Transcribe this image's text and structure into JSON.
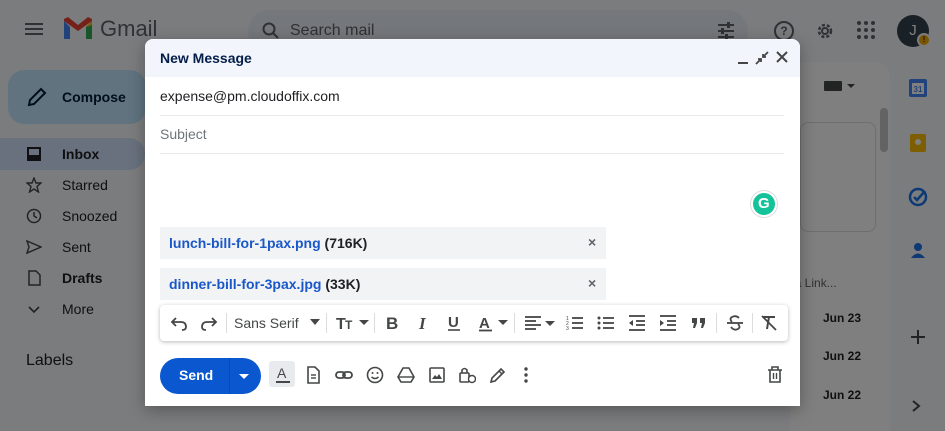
{
  "app": {
    "name": "Gmail",
    "search_placeholder": "Search mail",
    "avatar_letter": "J",
    "avatar_badge": "!"
  },
  "compose_button": {
    "label": "Compose"
  },
  "sidebar": {
    "items": [
      {
        "label": "Inbox",
        "icon": "inbox-icon",
        "active": true
      },
      {
        "label": "Starred",
        "icon": "star-icon"
      },
      {
        "label": "Snoozed",
        "icon": "clock-icon"
      },
      {
        "label": "Sent",
        "icon": "send-icon"
      },
      {
        "label": "Drafts",
        "icon": "draft-icon"
      },
      {
        "label": "More",
        "icon": "chevron-down-icon"
      }
    ],
    "labels_heading": "Labels"
  },
  "mail_list": {
    "fragment": "ia Link...",
    "dates": [
      "Jun 23",
      "Jun 22",
      "Jun 22"
    ]
  },
  "compose": {
    "title": "New Message",
    "to": "expense@pm.cloudoffix.com",
    "subject_placeholder": "Subject",
    "attachments": [
      {
        "name": "lunch-bill-for-1pax.png",
        "size": "(716K)"
      },
      {
        "name": "dinner-bill-for-3pax.jpg",
        "size": "(33K)"
      }
    ],
    "attachment_remove": "×",
    "grammarly_letter": "G",
    "font": "Sans Serif",
    "send_label": "Send"
  },
  "colors": {
    "accent": "#0b57d0",
    "compose_bg": "#c2e7ff",
    "active_nav": "#d3e3fd",
    "link": "#1a57c9"
  }
}
